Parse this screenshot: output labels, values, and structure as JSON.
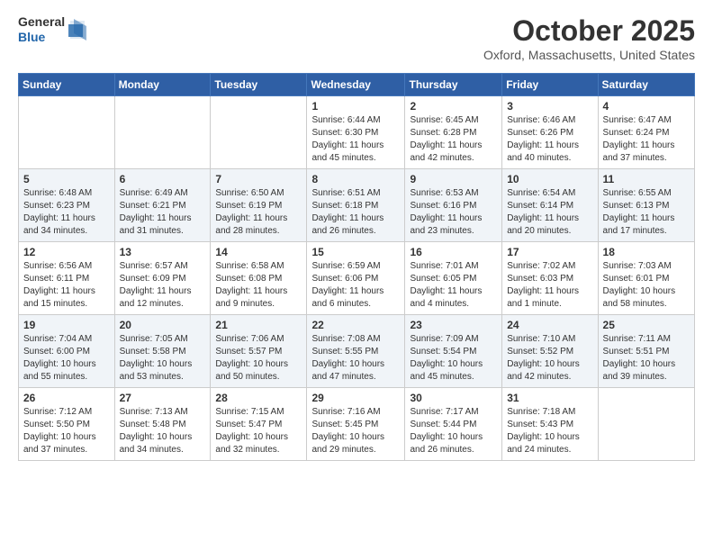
{
  "header": {
    "logo": {
      "general": "General",
      "blue": "Blue"
    },
    "title": "October 2025",
    "location": "Oxford, Massachusetts, United States"
  },
  "weekdays": [
    "Sunday",
    "Monday",
    "Tuesday",
    "Wednesday",
    "Thursday",
    "Friday",
    "Saturday"
  ],
  "weeks": [
    [
      {
        "day": "",
        "info": ""
      },
      {
        "day": "",
        "info": ""
      },
      {
        "day": "",
        "info": ""
      },
      {
        "day": "1",
        "info": "Sunrise: 6:44 AM\nSunset: 6:30 PM\nDaylight: 11 hours and 45 minutes."
      },
      {
        "day": "2",
        "info": "Sunrise: 6:45 AM\nSunset: 6:28 PM\nDaylight: 11 hours and 42 minutes."
      },
      {
        "day": "3",
        "info": "Sunrise: 6:46 AM\nSunset: 6:26 PM\nDaylight: 11 hours and 40 minutes."
      },
      {
        "day": "4",
        "info": "Sunrise: 6:47 AM\nSunset: 6:24 PM\nDaylight: 11 hours and 37 minutes."
      }
    ],
    [
      {
        "day": "5",
        "info": "Sunrise: 6:48 AM\nSunset: 6:23 PM\nDaylight: 11 hours and 34 minutes."
      },
      {
        "day": "6",
        "info": "Sunrise: 6:49 AM\nSunset: 6:21 PM\nDaylight: 11 hours and 31 minutes."
      },
      {
        "day": "7",
        "info": "Sunrise: 6:50 AM\nSunset: 6:19 PM\nDaylight: 11 hours and 28 minutes."
      },
      {
        "day": "8",
        "info": "Sunrise: 6:51 AM\nSunset: 6:18 PM\nDaylight: 11 hours and 26 minutes."
      },
      {
        "day": "9",
        "info": "Sunrise: 6:53 AM\nSunset: 6:16 PM\nDaylight: 11 hours and 23 minutes."
      },
      {
        "day": "10",
        "info": "Sunrise: 6:54 AM\nSunset: 6:14 PM\nDaylight: 11 hours and 20 minutes."
      },
      {
        "day": "11",
        "info": "Sunrise: 6:55 AM\nSunset: 6:13 PM\nDaylight: 11 hours and 17 minutes."
      }
    ],
    [
      {
        "day": "12",
        "info": "Sunrise: 6:56 AM\nSunset: 6:11 PM\nDaylight: 11 hours and 15 minutes."
      },
      {
        "day": "13",
        "info": "Sunrise: 6:57 AM\nSunset: 6:09 PM\nDaylight: 11 hours and 12 minutes."
      },
      {
        "day": "14",
        "info": "Sunrise: 6:58 AM\nSunset: 6:08 PM\nDaylight: 11 hours and 9 minutes."
      },
      {
        "day": "15",
        "info": "Sunrise: 6:59 AM\nSunset: 6:06 PM\nDaylight: 11 hours and 6 minutes."
      },
      {
        "day": "16",
        "info": "Sunrise: 7:01 AM\nSunset: 6:05 PM\nDaylight: 11 hours and 4 minutes."
      },
      {
        "day": "17",
        "info": "Sunrise: 7:02 AM\nSunset: 6:03 PM\nDaylight: 11 hours and 1 minute."
      },
      {
        "day": "18",
        "info": "Sunrise: 7:03 AM\nSunset: 6:01 PM\nDaylight: 10 hours and 58 minutes."
      }
    ],
    [
      {
        "day": "19",
        "info": "Sunrise: 7:04 AM\nSunset: 6:00 PM\nDaylight: 10 hours and 55 minutes."
      },
      {
        "day": "20",
        "info": "Sunrise: 7:05 AM\nSunset: 5:58 PM\nDaylight: 10 hours and 53 minutes."
      },
      {
        "day": "21",
        "info": "Sunrise: 7:06 AM\nSunset: 5:57 PM\nDaylight: 10 hours and 50 minutes."
      },
      {
        "day": "22",
        "info": "Sunrise: 7:08 AM\nSunset: 5:55 PM\nDaylight: 10 hours and 47 minutes."
      },
      {
        "day": "23",
        "info": "Sunrise: 7:09 AM\nSunset: 5:54 PM\nDaylight: 10 hours and 45 minutes."
      },
      {
        "day": "24",
        "info": "Sunrise: 7:10 AM\nSunset: 5:52 PM\nDaylight: 10 hours and 42 minutes."
      },
      {
        "day": "25",
        "info": "Sunrise: 7:11 AM\nSunset: 5:51 PM\nDaylight: 10 hours and 39 minutes."
      }
    ],
    [
      {
        "day": "26",
        "info": "Sunrise: 7:12 AM\nSunset: 5:50 PM\nDaylight: 10 hours and 37 minutes."
      },
      {
        "day": "27",
        "info": "Sunrise: 7:13 AM\nSunset: 5:48 PM\nDaylight: 10 hours and 34 minutes."
      },
      {
        "day": "28",
        "info": "Sunrise: 7:15 AM\nSunset: 5:47 PM\nDaylight: 10 hours and 32 minutes."
      },
      {
        "day": "29",
        "info": "Sunrise: 7:16 AM\nSunset: 5:45 PM\nDaylight: 10 hours and 29 minutes."
      },
      {
        "day": "30",
        "info": "Sunrise: 7:17 AM\nSunset: 5:44 PM\nDaylight: 10 hours and 26 minutes."
      },
      {
        "day": "31",
        "info": "Sunrise: 7:18 AM\nSunset: 5:43 PM\nDaylight: 10 hours and 24 minutes."
      },
      {
        "day": "",
        "info": ""
      }
    ]
  ]
}
